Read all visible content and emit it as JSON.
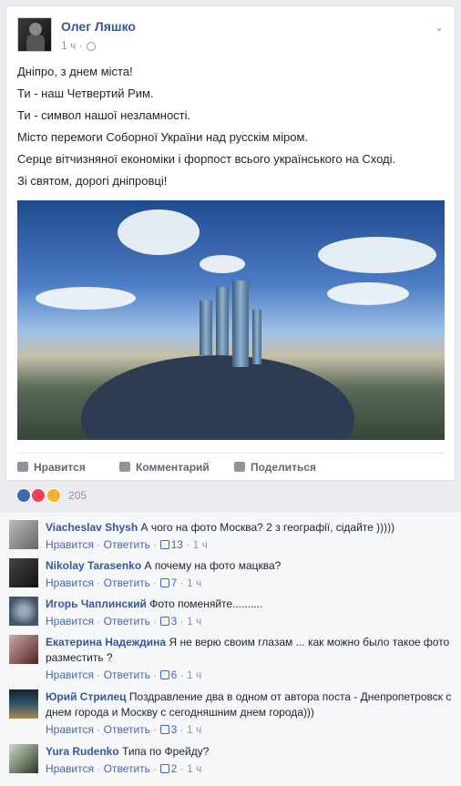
{
  "post": {
    "author": "Олег Ляшко",
    "time": "1 ч",
    "lines": [
      "Дніпро, з днем міста!",
      "Ти - наш Четвертий Рим.",
      "Ти - символ нашої незламності.",
      "Місто перемоги Соборної України над русскім міром.",
      "Серце вітчизняної економіки і форпост всього українського на Сході.",
      "Зі святом, дорогі дніпровці!"
    ],
    "actions": {
      "like": "Нравится",
      "comment": "Комментарий",
      "share": "Поделиться"
    },
    "reaction_count": "205"
  },
  "comment_actions": {
    "like": "Нравится",
    "reply": "Ответить",
    "sep": "·"
  },
  "comments": [
    {
      "name": "Viacheslav Shysh",
      "text": "А чого на фото Москва? 2 з географії, сідайте )))))",
      "likes": "13",
      "time": "1 ч"
    },
    {
      "name": "Nikolay Tarasenko",
      "text": "А почему на фото мацква?",
      "likes": "7",
      "time": "1 ч"
    },
    {
      "name": "Игорь Чаплинский",
      "text": "Фото поменяйте..........",
      "likes": "3",
      "time": "1 ч"
    },
    {
      "name": "Екатерина Надеждина",
      "text": "Я не верю своим глазам ... как можно было такое фото разместить ?",
      "likes": "6",
      "time": "1 ч"
    },
    {
      "name": "Юрий Стрилец",
      "text": "Поздравление два в одном от автора поста - Днепропетровск с днем города и Москву с сегодняшним днем города)))",
      "likes": "3",
      "time": "1 ч"
    },
    {
      "name": "Yura Rudenko",
      "text": "Типа по Фрейду?",
      "likes": "2",
      "time": "1 ч"
    }
  ],
  "colors": {
    "link": "#365899",
    "like_blue": "#4267b2",
    "muted": "#90949c"
  }
}
